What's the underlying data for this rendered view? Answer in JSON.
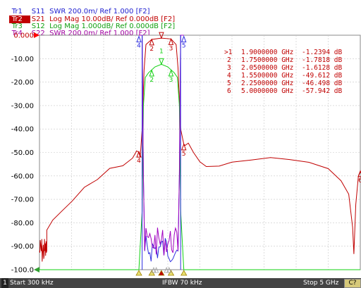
{
  "traces": [
    {
      "id": "Tr1",
      "desc": "S11  SWR 200.0m/ Ref 1.000 [F2]",
      "color": "#2020d0",
      "active": false
    },
    {
      "id": "Tr2",
      "desc": "S21  Log Mag 10.00dB/ Ref 0.000dB [F2]",
      "color": "#c00000",
      "active": true
    },
    {
      "id": "Tr3",
      "desc": "S12  Log Mag 1.000dB/ Ref 0.000dB [F2]",
      "color": "#10a010",
      "active": false
    },
    {
      "id": "Tr4",
      "desc": "S22  SWR 200.0m/ Ref 1.000 [F2]",
      "color": "#a000a0",
      "active": false
    }
  ],
  "y_axis": {
    "labels": [
      "0.000",
      "-10.00",
      "-20.00",
      "-30.00",
      "-40.00",
      "-50.00",
      "-60.00",
      "-70.00",
      "-80.00",
      "-90.00",
      "-100.0"
    ]
  },
  "markers": [
    {
      "label": ">1",
      "freq": "1.9000000 GHz",
      "val": "-1.2394 dB"
    },
    {
      "label": "2",
      "freq": "1.7500000 GHz",
      "val": "-1.7818 dB"
    },
    {
      "label": "3",
      "freq": "2.0500000 GHz",
      "val": "-1.6128 dB"
    },
    {
      "label": "4",
      "freq": "1.5500000 GHz",
      "val": "-49.612 dB"
    },
    {
      "label": "5",
      "freq": "2.2500000 GHz",
      "val": "-46.498 dB"
    },
    {
      "label": "6",
      "freq": "5.0000000 GHz",
      "val": "-57.942 dB"
    }
  ],
  "status": {
    "channel": "1",
    "start": "Start 300 kHz",
    "ifbw": "IFBW 70 kHz",
    "stop": "Stop 5 GHz",
    "cal": "C?"
  },
  "colors": {
    "s21": "#c00000",
    "s12": "#10d010",
    "s11": "#3030e0",
    "s22": "#a000c0",
    "grid": "#c8c8c8",
    "ref": "#ff0000"
  }
}
